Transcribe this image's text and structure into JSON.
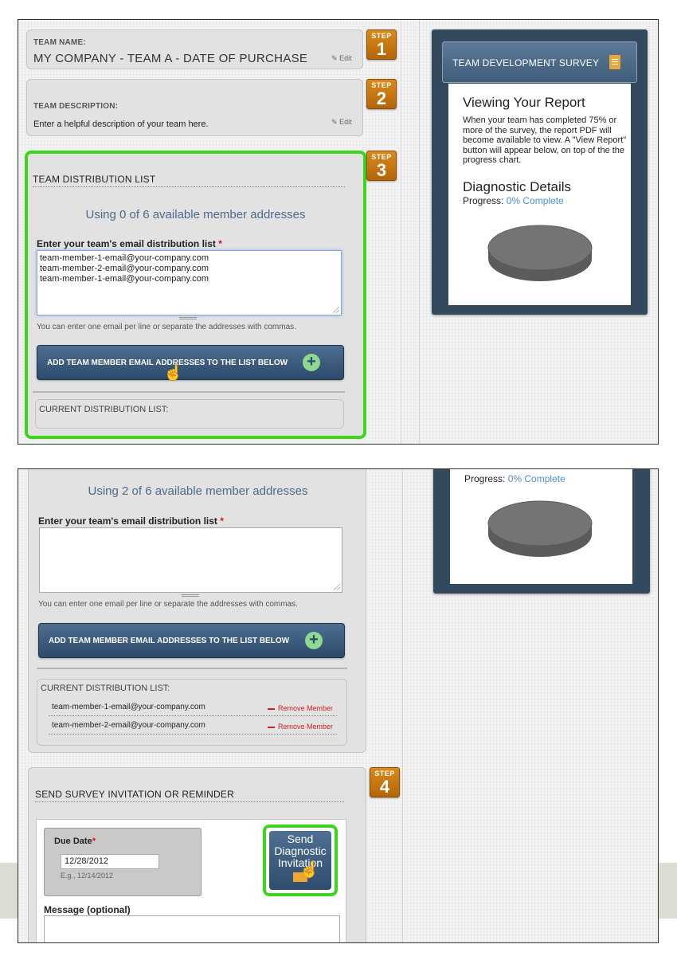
{
  "top": {
    "team_name": {
      "label": "TEAM NAME:",
      "value": "MY COMPANY - TEAM A - DATE OF PURCHASE",
      "edit": "Edit"
    },
    "team_description": {
      "label": "TEAM DESCRIPTION:",
      "value": "Enter a helpful description of your team here.",
      "edit": "Edit"
    },
    "steps": {
      "word": "STEP",
      "s1": "1",
      "s2": "2",
      "s3": "3",
      "s4": "4"
    },
    "distribution": {
      "title": "TEAM DISTRIBUTION LIST",
      "using": "Using 0 of 6 available member addresses",
      "list_label": "Enter your team's email distribution list",
      "required": "*",
      "emails": [
        "team-member-1-email@your-company.com",
        "team-member-2-email@your-company.com",
        "team-member-1-email@your-company.com"
      ],
      "hint": "You can enter one email per line or separate the addresses with commas.",
      "add_button": "ADD TEAM MEMBER EMAIL ADDRESSES TO THE LIST BELOW",
      "current_label": "CURRENT DISTRIBUTION LIST:"
    },
    "survey": {
      "header": "TEAM DEVELOPMENT SURVEY",
      "viewing_title": "Viewing Your Report",
      "viewing_text": "When your team has completed 75% or more of the survey, the report PDF will become available to view. A \"View Report\" button will appear below, on top of the the progress chart.",
      "diag_title": "Diagnostic Details",
      "progress_label": "Progress:",
      "progress_value": "0% Complete",
      "progress_fraction": 0
    }
  },
  "bottom": {
    "using": "Using 2 of 6 available member addresses",
    "list_label": "Enter your team's email distribution list",
    "required": "*",
    "hint": "You can enter one email per line or separate the addresses with commas.",
    "add_button": "ADD TEAM MEMBER EMAIL ADDRESSES TO THE LIST BELOW",
    "current_label": "CURRENT DISTRIBUTION LIST:",
    "members": [
      {
        "email": "team-member-1-email@your-company.com",
        "remove": "Remove Member"
      },
      {
        "email": "team-member-2-email@your-company.com",
        "remove": "Remove Member"
      }
    ],
    "progress_label": "Progress:",
    "progress_value": "0% Complete",
    "send": {
      "title": "SEND SURVEY INVITATION OR REMINDER",
      "due_label": "Due Date",
      "required": "*",
      "due_value": "12/28/2012",
      "due_example": "E.g., 12/14/2012",
      "send_button_l1": "Send",
      "send_button_l2": "Diagnostic",
      "send_button_l3": "Invitation",
      "message_label": "Message (optional)"
    }
  },
  "colors": {
    "accent_green": "#3cd71c",
    "step_orange": "#c87813",
    "panel_navy": "#33495e",
    "link_blue": "#4f8fcf"
  }
}
